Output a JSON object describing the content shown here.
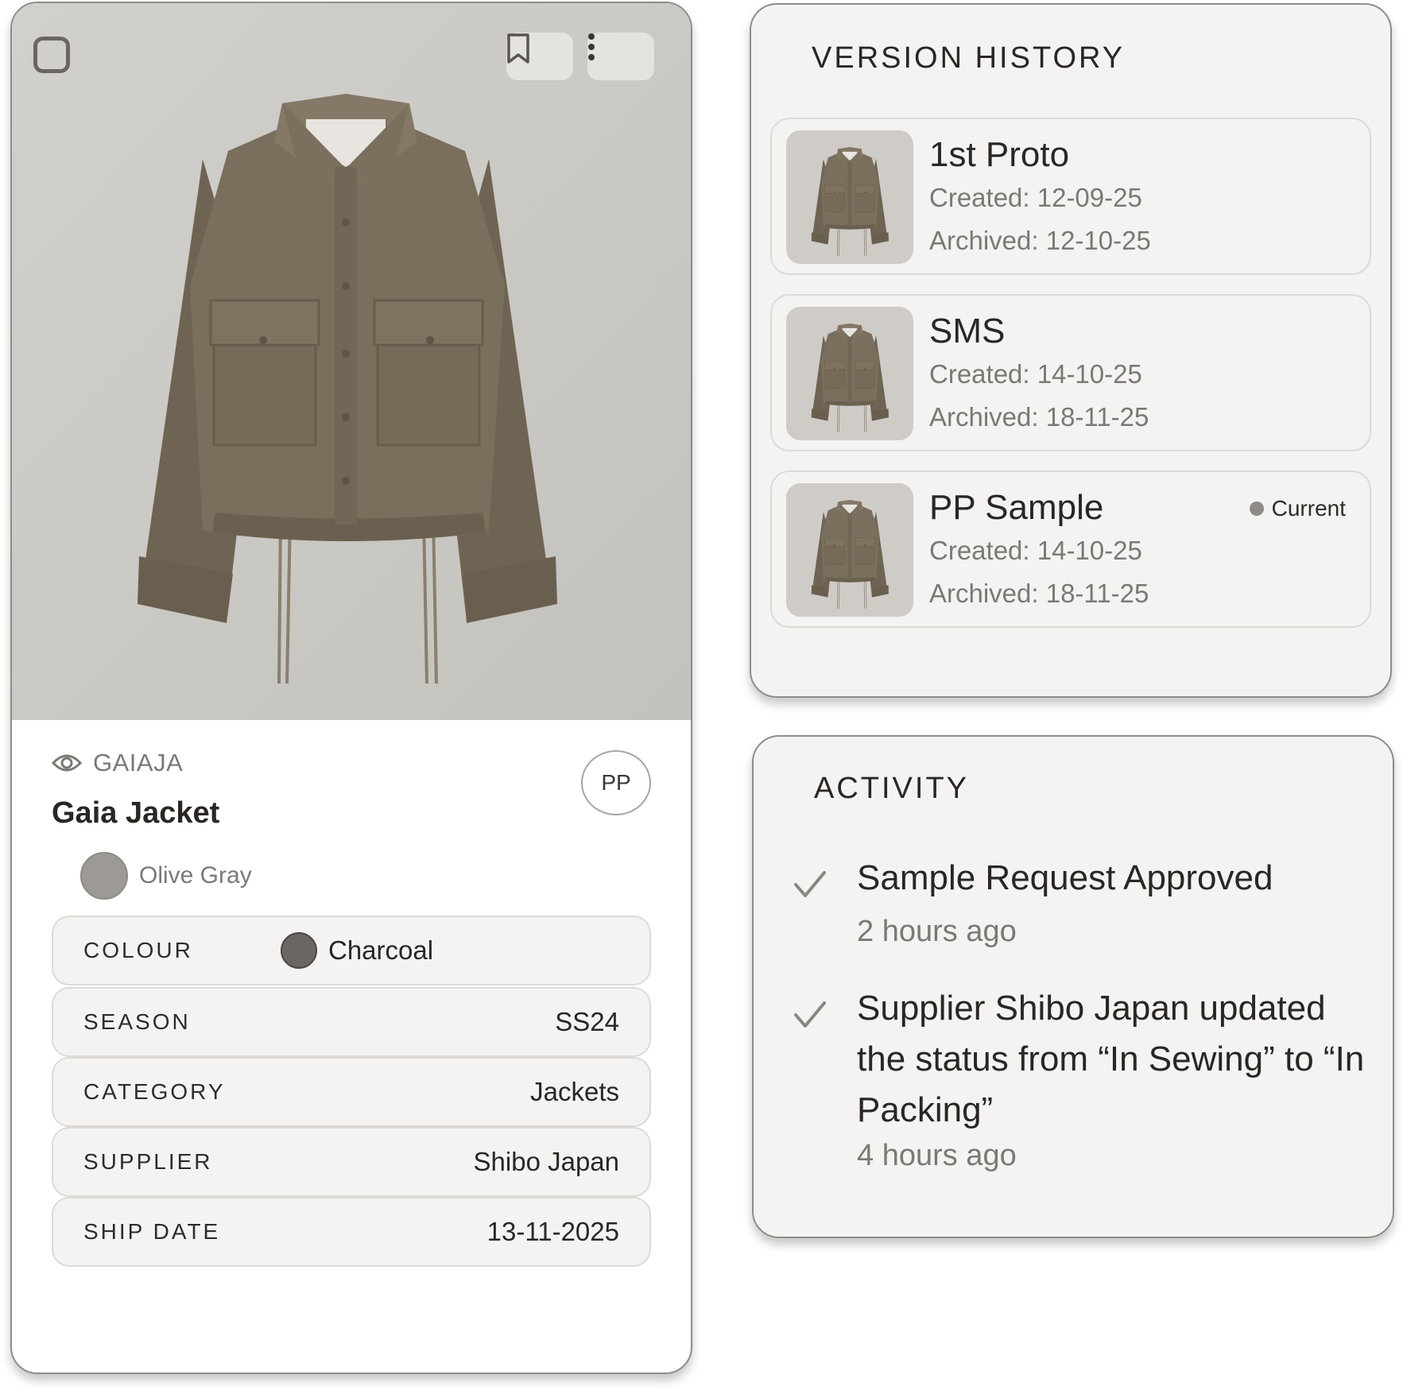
{
  "product": {
    "code": "GAIAJA",
    "name": "Gaia Jacket",
    "stage_badge": "PP",
    "color_name": "Olive Gray",
    "attributes": {
      "colour_label": "COLOUR",
      "colour_value": "Charcoal",
      "season_label": "SEASON",
      "season_value": "SS24",
      "category_label": "CATEGORY",
      "category_value": "Jackets",
      "supplier_label": "SUPPLIER",
      "supplier_value": "Shibo Japan",
      "ship_date_label": "SHIP DATE",
      "ship_date_value": "13-11-2025"
    },
    "icons": [
      "checkbox-icon",
      "bookmark-icon",
      "more-vertical-icon",
      "eye-icon"
    ]
  },
  "version_history": {
    "title": "VERSION HISTORY",
    "items": [
      {
        "name": "1st Proto",
        "created": "Created: 12-09-25",
        "archived": "Archived: 12-10-25"
      },
      {
        "name": "SMS",
        "created": "Created: 14-10-25",
        "archived": "Archived: 18-11-25"
      },
      {
        "name": "PP Sample",
        "created": "Created: 14-10-25",
        "archived": "Archived: 18-11-25",
        "badge": "Current"
      }
    ]
  },
  "activity": {
    "title": "ACTIVITY",
    "items": [
      {
        "text": "Sample Request Approved",
        "time": "2 hours ago"
      },
      {
        "text": "Supplier Shibo Japan updated the status from “In Sewing” to “In Packing”",
        "time": "4 hours ago"
      }
    ]
  },
  "colors": {
    "olive_gray": "#9d9995",
    "charcoal": "#6b6663",
    "panel_bg": "#f4f3f1",
    "jacket": "#7a6e5d"
  }
}
